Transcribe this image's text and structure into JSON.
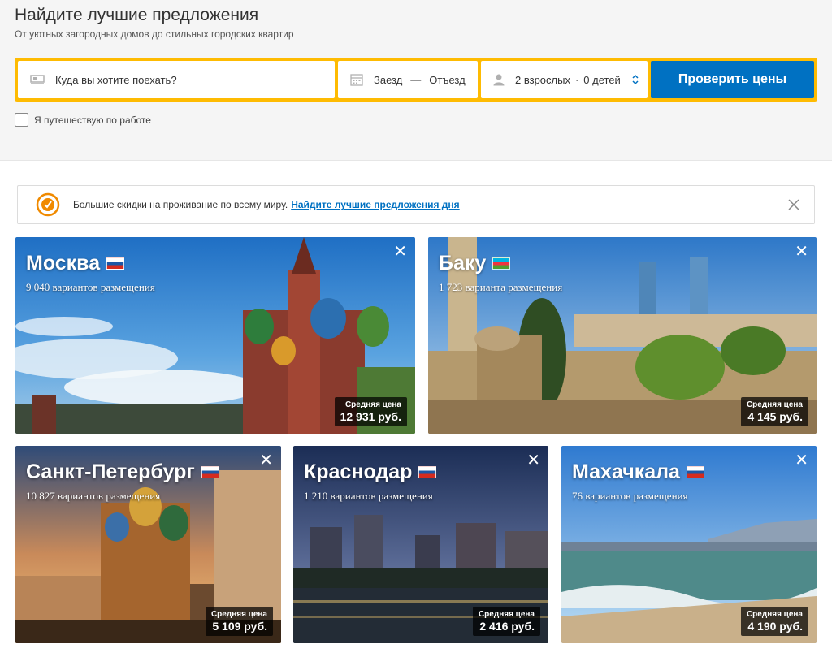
{
  "hero": {
    "title": "Найдите лучшие предложения",
    "subtitle": "От уютных загородных домов до стильных городских квартир"
  },
  "search": {
    "destination_placeholder": "Куда вы хотите поехать?",
    "checkin": "Заезд",
    "checkout": "Отъезд",
    "adults": "2 взрослых",
    "children": "0 детей",
    "button": "Проверить цены",
    "work_travel": "Я путешествую по работе"
  },
  "banner": {
    "text": "Большие скидки на проживание по всему миру.",
    "link": "Найдите лучшие предложения дня"
  },
  "price_label": "Средняя цена",
  "cities": [
    {
      "name": "Москва",
      "count": "9 040 вариантов размещения",
      "price": "12 931 руб.",
      "flag": "ru"
    },
    {
      "name": "Баку",
      "count": "1 723 варианта размещения",
      "price": "4 145 руб.",
      "flag": "az"
    },
    {
      "name": "Санкт-Петербург",
      "count": "10 827 вариантов размещения",
      "price": "5 109 руб.",
      "flag": "ru"
    },
    {
      "name": "Краснодар",
      "count": "1 210 вариантов размещения",
      "price": "2 416 руб.",
      "flag": "ru"
    },
    {
      "name": "Махачкала",
      "count": "76 вариантов размещения",
      "price": "4 190 руб.",
      "flag": "ru"
    }
  ],
  "colors": {
    "accent_yellow": "#febb02",
    "button_blue": "#0071c2"
  }
}
